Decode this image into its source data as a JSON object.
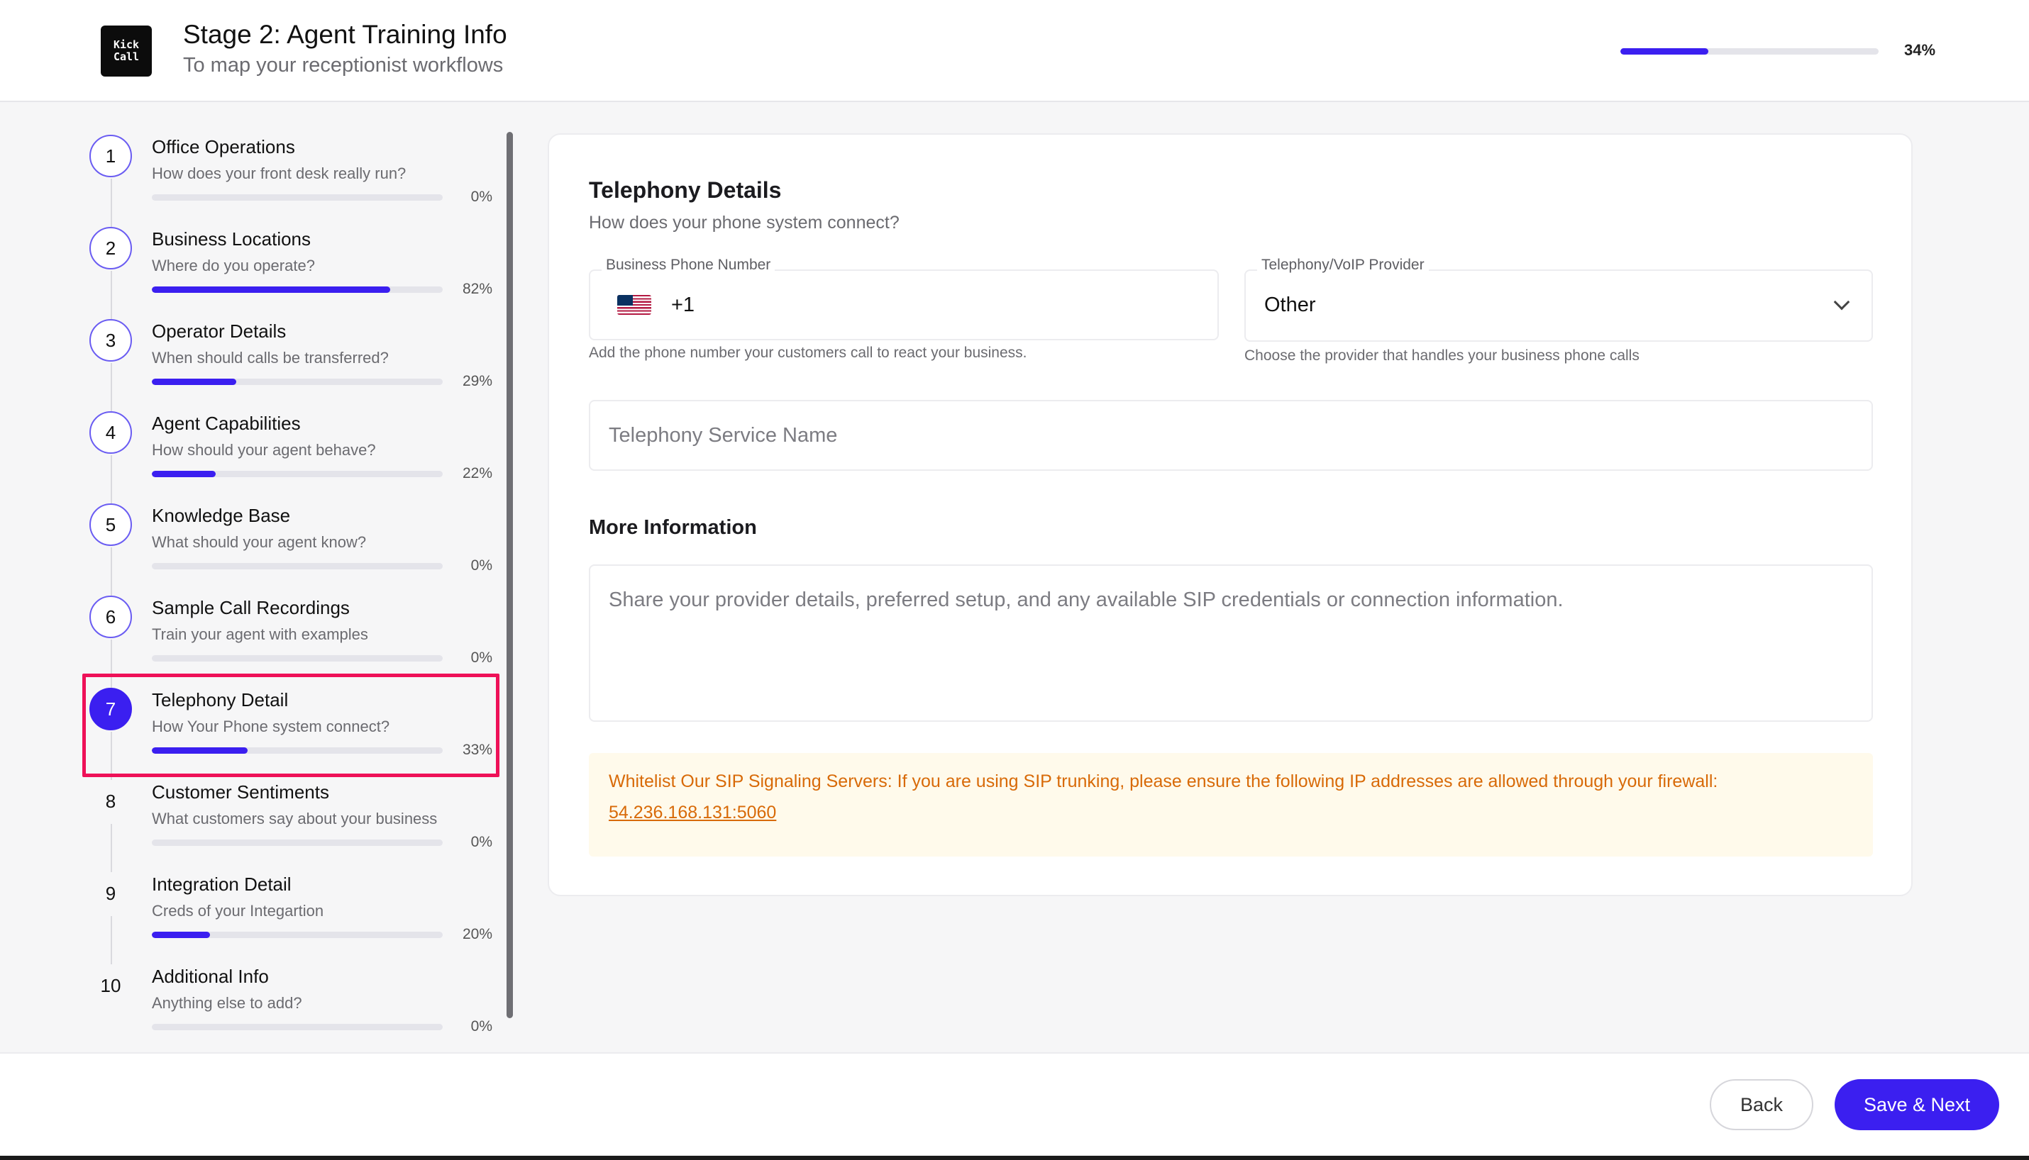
{
  "header": {
    "logo_line1": "Kick",
    "logo_line2": "Call",
    "title": "Stage 2: Agent Training Info",
    "subtitle": "To map your receptionist workflows",
    "progress_percent": 34,
    "progress_label": "34%"
  },
  "steps": [
    {
      "number": "1",
      "title": "Office Operations",
      "subtitle": "How does your front desk really run?",
      "progress": 0,
      "progress_label": "0%"
    },
    {
      "number": "2",
      "title": "Business Locations",
      "subtitle": "Where do you operate?",
      "progress": 82,
      "progress_label": "82%"
    },
    {
      "number": "3",
      "title": "Operator Details",
      "subtitle": "When should calls be transferred?",
      "progress": 29,
      "progress_label": "29%"
    },
    {
      "number": "4",
      "title": "Agent Capabilities",
      "subtitle": "How should your agent behave?",
      "progress": 22,
      "progress_label": "22%"
    },
    {
      "number": "5",
      "title": "Knowledge Base",
      "subtitle": "What should your agent know?",
      "progress": 0,
      "progress_label": "0%"
    },
    {
      "number": "6",
      "title": "Sample Call Recordings",
      "subtitle": "Train your agent with examples",
      "progress": 0,
      "progress_label": "0%"
    },
    {
      "number": "7",
      "title": "Telephony Detail",
      "subtitle": "How Your Phone system connect?",
      "progress": 33,
      "progress_label": "33%"
    },
    {
      "number": "8",
      "title": "Customer Sentiments",
      "subtitle": "What customers say about your business",
      "progress": 0,
      "progress_label": "0%"
    },
    {
      "number": "9",
      "title": "Integration Detail",
      "subtitle": "Creds of your Integartion",
      "progress": 20,
      "progress_label": "20%"
    },
    {
      "number": "10",
      "title": "Additional Info",
      "subtitle": "Anything else to add?",
      "progress": 0,
      "progress_label": "0%"
    }
  ],
  "active_step": 7,
  "form": {
    "title": "Telephony Details",
    "subtitle": "How does your phone system connect?",
    "phone": {
      "label": "Business Phone Number",
      "country_code": "+1",
      "flag_icon": "us-flag-icon",
      "helper": "Add the phone number your customers call to react your business."
    },
    "provider": {
      "label": "Telephony/VoIP Provider",
      "value": "Other",
      "helper": "Choose the provider that handles your business phone calls"
    },
    "service_name": {
      "placeholder": "Telephony Service Name"
    },
    "more_info": {
      "title": "More Information",
      "placeholder": "Share your provider details, preferred setup, and any available SIP credentials or connection information."
    },
    "notice": {
      "text": "Whitelist Our SIP Signaling Servers: If you are using SIP trunking, please ensure the following IP addresses are allowed through your firewall:",
      "address": "54.236.168.131:5060"
    }
  },
  "footer": {
    "back_label": "Back",
    "next_label": "Save & Next"
  },
  "colors": {
    "accent": "#3b1ff0",
    "highlight_border": "#ee1158",
    "notice_text": "#d86a08",
    "notice_bg": "#fffaeb"
  }
}
